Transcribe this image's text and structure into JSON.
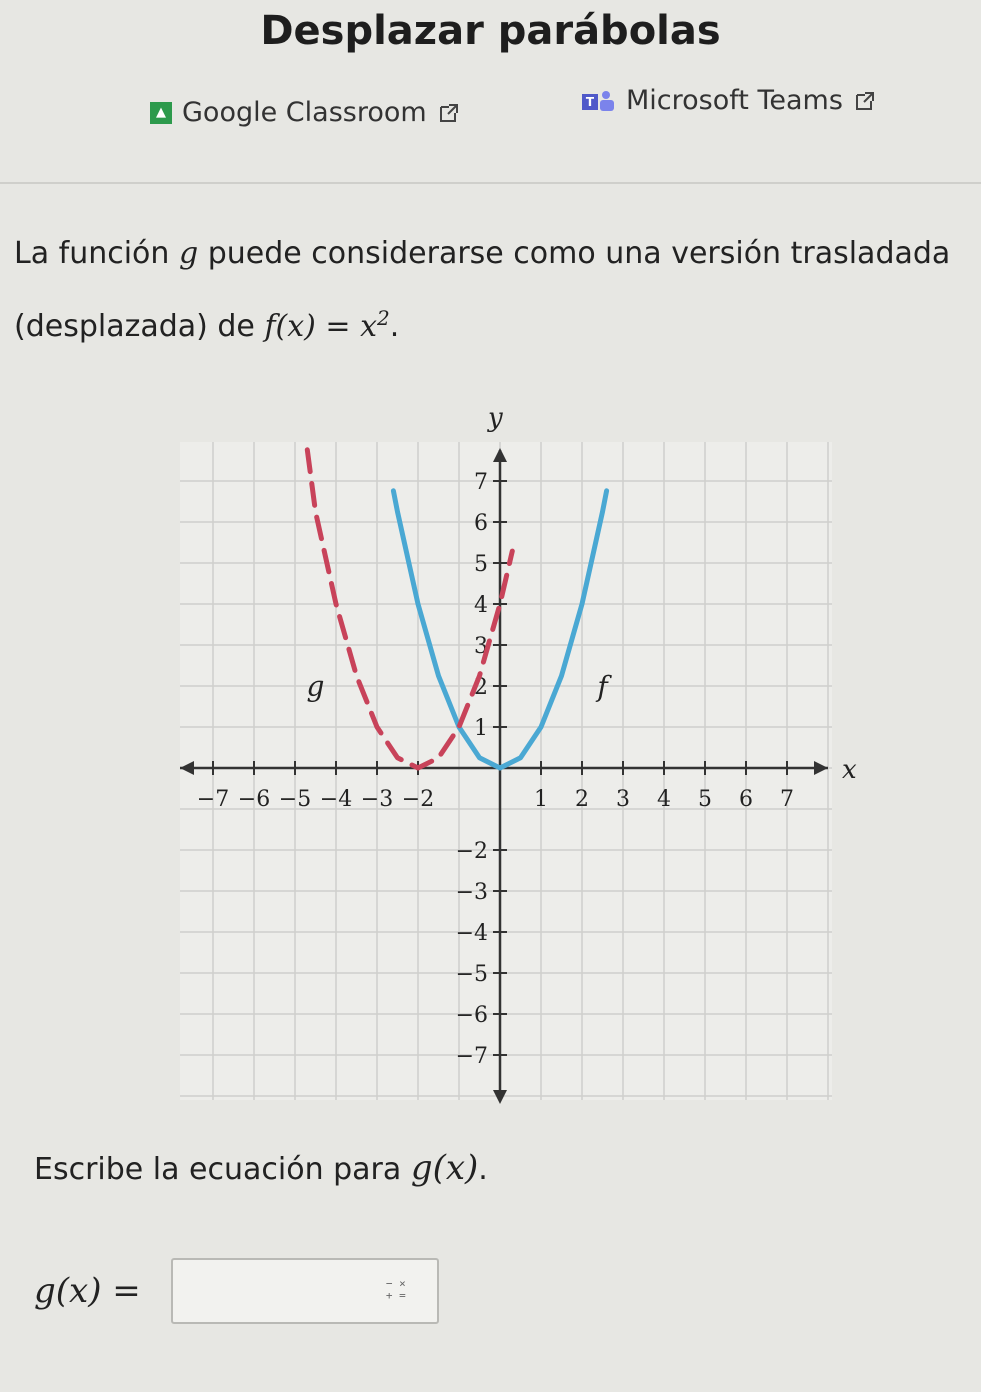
{
  "header": {
    "title": "Desplazar parábolas",
    "share": {
      "google_classroom": "Google Classroom",
      "microsoft_teams": "Microsoft Teams"
    }
  },
  "question": {
    "intro": "La función",
    "g": "g",
    "middle": "puede considerarse como una versión trasladada (desplazada) de",
    "f_expr": "f(x) = x",
    "f_exp": "2",
    "end": "."
  },
  "chart_data": {
    "type": "line",
    "xlabel": "x",
    "ylabel": "y",
    "xlim": [
      -7,
      7
    ],
    "ylim": [
      -7,
      7
    ],
    "x_ticks": [
      -7,
      -6,
      -5,
      -4,
      -3,
      -2,
      1,
      2,
      3,
      4,
      5,
      6,
      7
    ],
    "y_ticks": [
      -7,
      -6,
      -5,
      -4,
      -3,
      -2,
      1,
      2,
      3,
      4,
      5,
      6,
      7
    ],
    "grid": true,
    "series": [
      {
        "name": "f",
        "color": "#4aa8d3",
        "style": "solid",
        "x": [
          -2.6,
          -2.5,
          -2,
          -1.5,
          -1,
          -0.5,
          0,
          0.5,
          1,
          1.5,
          2,
          2.5,
          2.6
        ],
        "y": [
          6.76,
          6.25,
          4,
          2.25,
          1,
          0.25,
          0,
          0.25,
          1,
          2.25,
          4,
          6.25,
          6.76
        ]
      },
      {
        "name": "g",
        "color": "#c8435a",
        "style": "dashed",
        "x": [
          -4.7,
          -4.5,
          -4,
          -3.5,
          -3,
          -2.5,
          -2,
          -1.5,
          -1,
          -0.5,
          0,
          0.3
        ],
        "y": [
          7.76,
          6.25,
          4,
          2.25,
          1,
          0.25,
          0,
          0.25,
          1,
          2.25,
          4,
          5.29
        ]
      }
    ],
    "labels": [
      {
        "text": "g",
        "x": -4.5,
        "y": 2
      },
      {
        "text": "f",
        "x": 2.5,
        "y": 2
      }
    ]
  },
  "prompt": {
    "text": "Escribe la ecuación para",
    "g_expr": "g(x)",
    "end": "."
  },
  "answer": {
    "label": "g(x) =",
    "value": "",
    "keypad_icon": "math-keypad-icon"
  }
}
